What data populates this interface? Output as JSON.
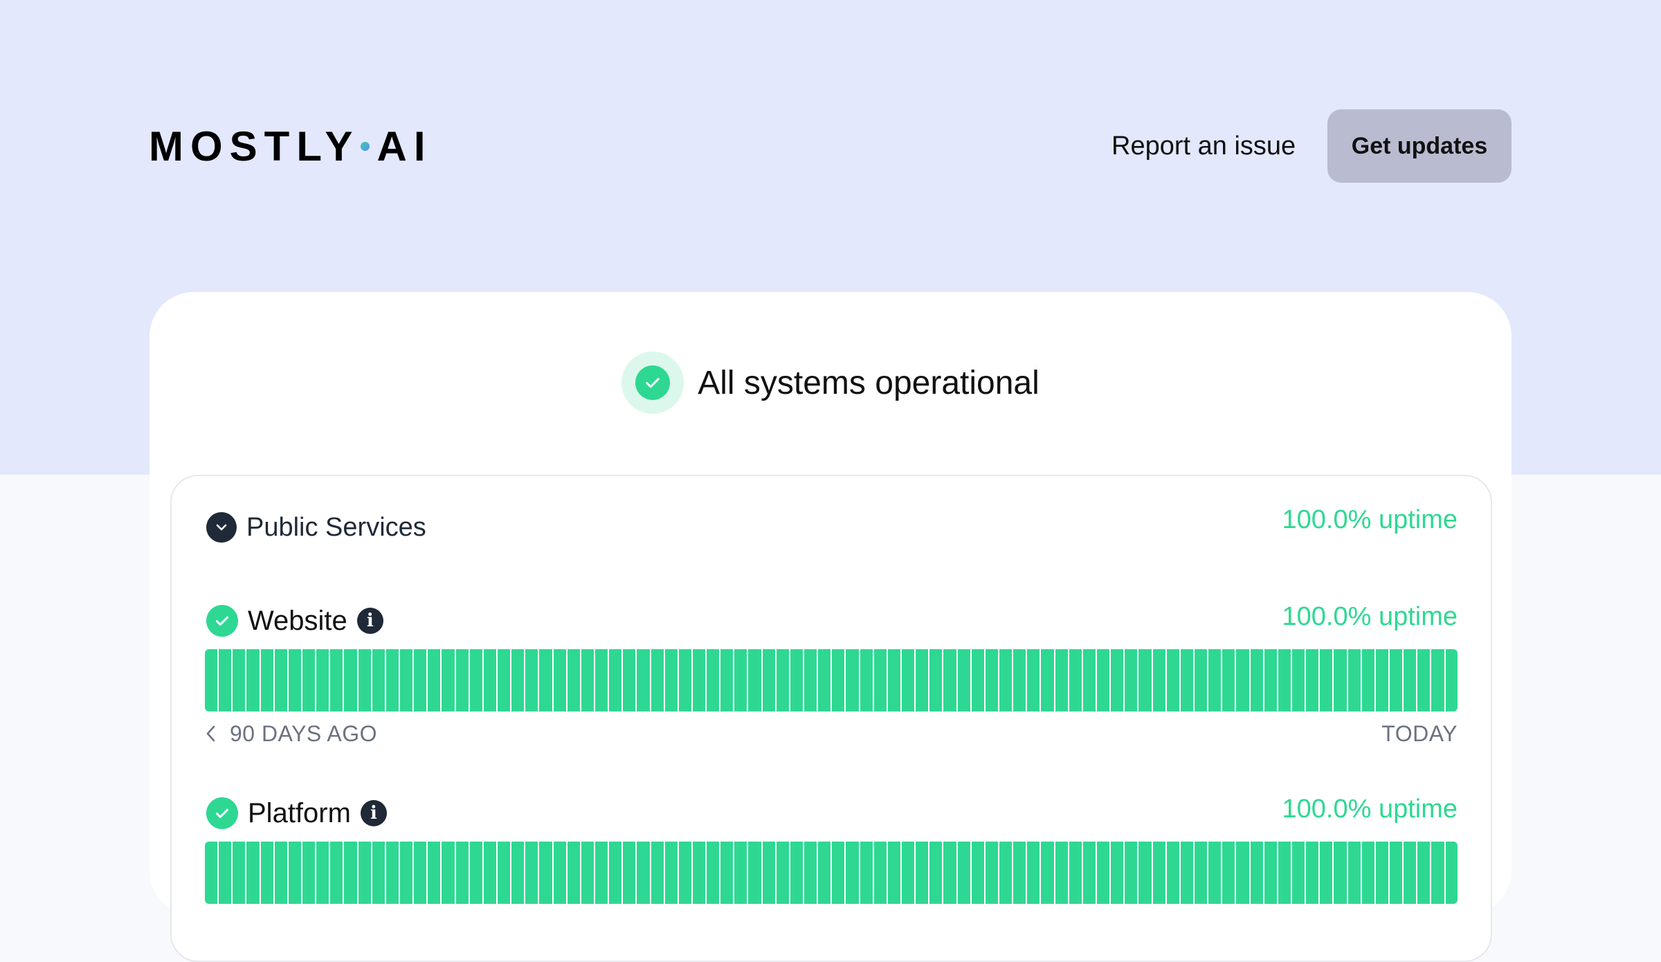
{
  "brand": {
    "logo_left": "MOSTLY",
    "logo_right": "AI"
  },
  "nav": {
    "report_label": "Report an issue",
    "updates_label": "Get updates"
  },
  "status": {
    "overall_text": "All systems operational"
  },
  "colors": {
    "operational": "#2ed892",
    "header_band": "#e3e8fc",
    "button_bg": "#b9bcd0",
    "dark": "#1f2937"
  },
  "group": {
    "name": "Public Services",
    "uptime": "100.0% uptime",
    "expanded": true,
    "services": [
      {
        "name": "Website",
        "uptime": "100.0% uptime",
        "status": "operational",
        "days": 90
      },
      {
        "name": "Platform",
        "uptime": "100.0% uptime",
        "status": "operational",
        "days": 90
      }
    ]
  },
  "range": {
    "start_label": "90 DAYS AGO",
    "end_label": "TODAY"
  }
}
